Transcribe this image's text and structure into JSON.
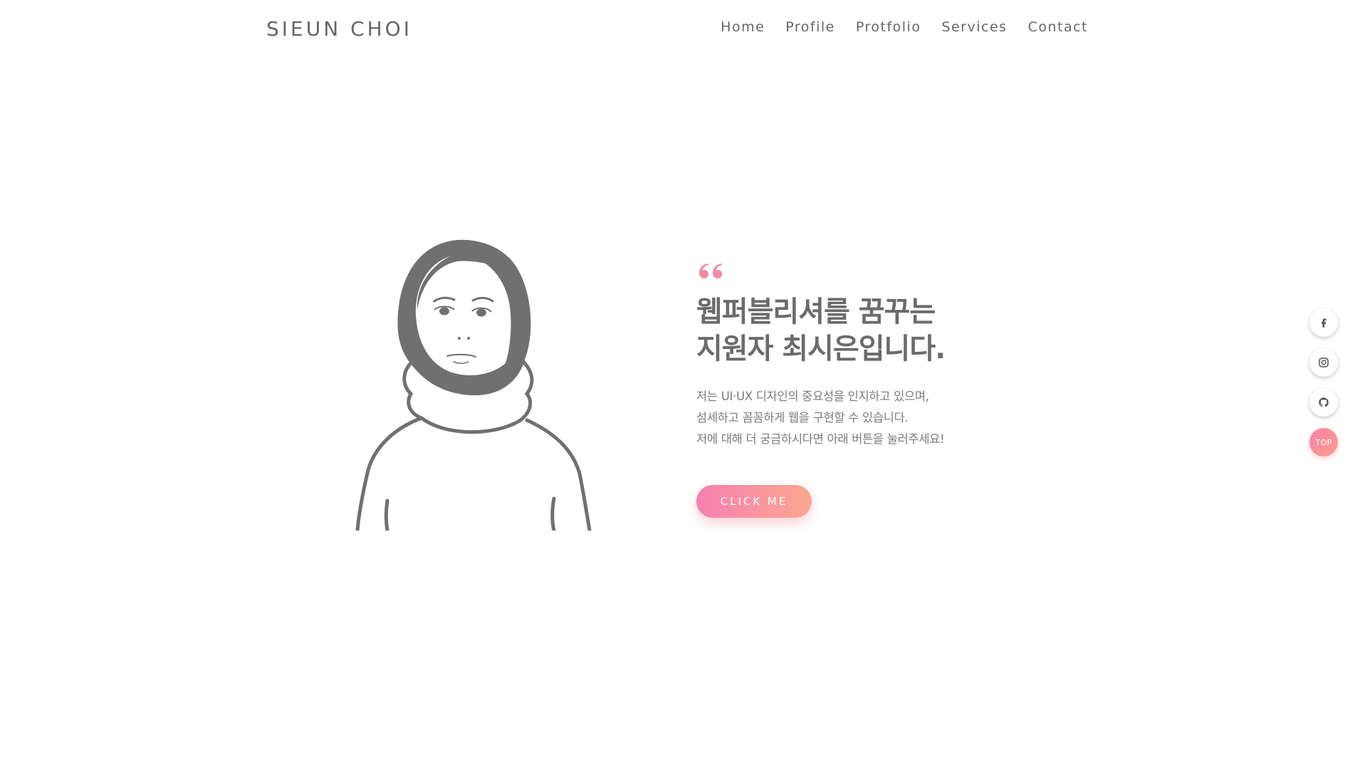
{
  "header": {
    "logo": "SIEUN CHOI",
    "nav": [
      "Home",
      "Profile",
      "Protfolio",
      "Services",
      "Contact"
    ]
  },
  "hero": {
    "quote_icon": "quote-open-icon",
    "headline_line1": "웹퍼블리셔를 꿈꾸는",
    "headline_line2": "지원자 최시은입니다.",
    "desc_line1": "저는 UI·UX 디자인의 중요성을 인지하고 있으며,",
    "desc_line2": "섬세하고 꼼꼼하게 웹을 구현할 수 있습니다.",
    "desc_line3": "저에 대해 더 궁금하시다면 아래 버튼을 눌러주세요!",
    "cta_label": "CLICK ME"
  },
  "side": {
    "icons": [
      "facebook-icon",
      "instagram-icon",
      "github-icon"
    ],
    "top_label": "TOP"
  },
  "colors": {
    "accent_start": "#f77fb0",
    "accent_end": "#fba88f",
    "text": "#6b6b6b",
    "illustration": "#707070"
  }
}
